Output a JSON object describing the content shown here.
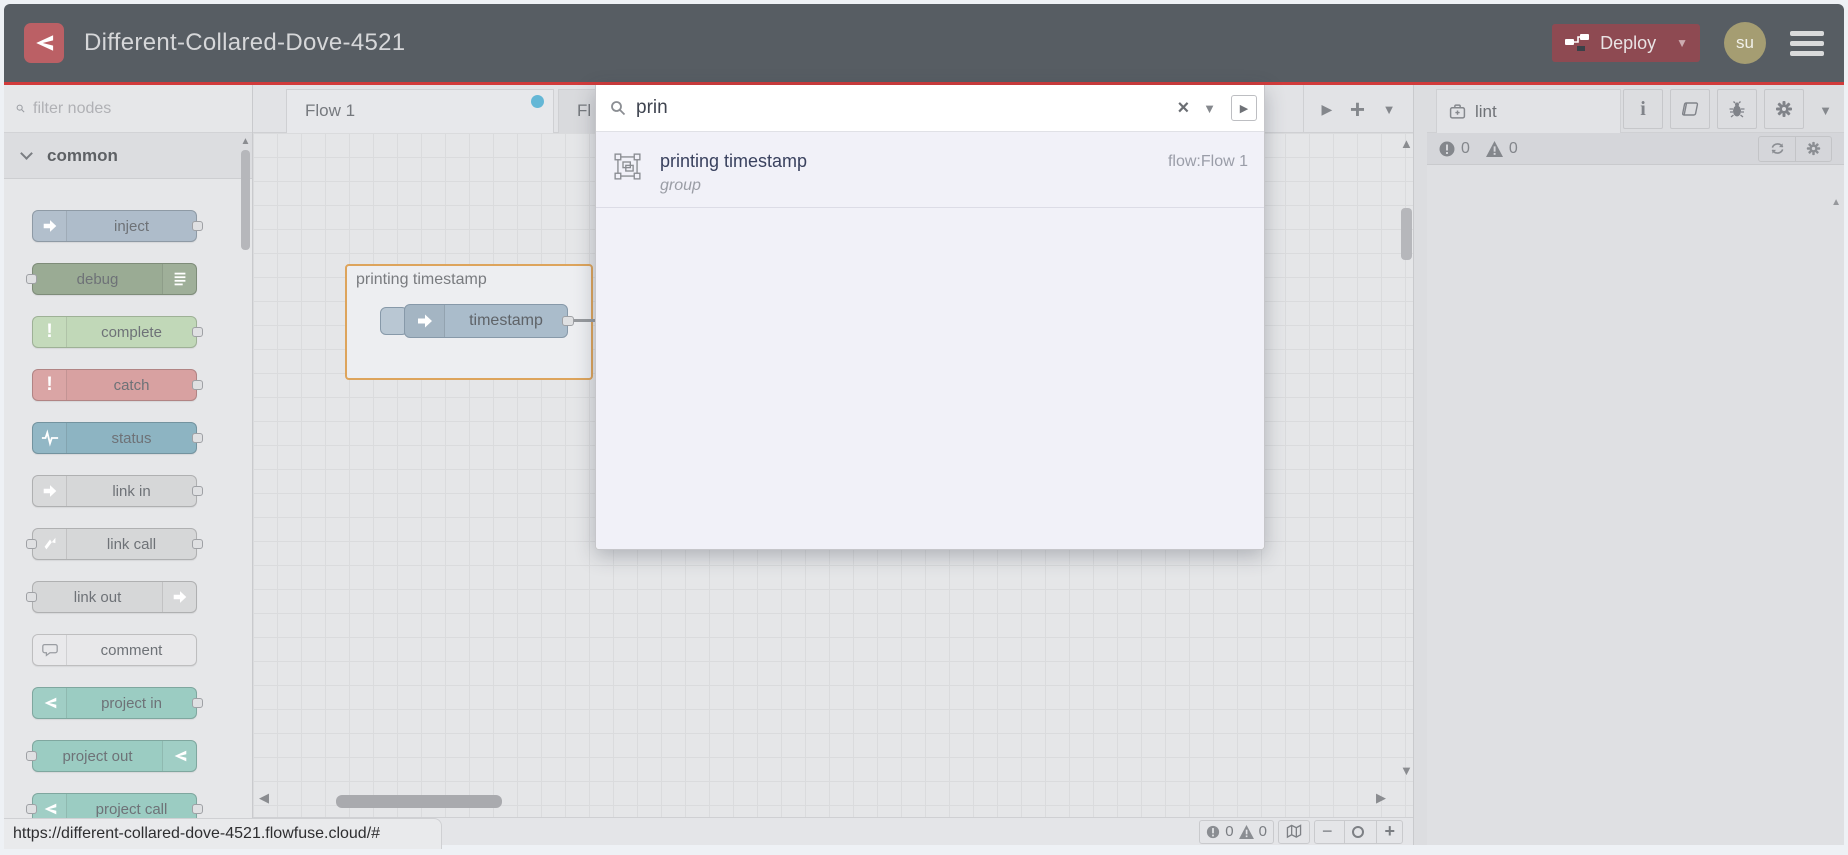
{
  "header": {
    "title": "Different-Collared-Dove-4521",
    "deploy_label": "Deploy",
    "avatar_initials": "su",
    "colors": {
      "bg": "#575d63",
      "accent_red": "#d13b3b",
      "deploy_bg": "#8e4a52",
      "avatar_bg": "#a59d72",
      "logo_bg": "#bb6065"
    }
  },
  "palette": {
    "filter_placeholder": "filter nodes",
    "category_label": "common",
    "nodes": [
      {
        "label": "inject",
        "color": "#aebcca"
      },
      {
        "label": "debug",
        "color": "#9aab94"
      },
      {
        "label": "complete",
        "color": "#c1d8b8"
      },
      {
        "label": "catch",
        "color": "#d8a1a1"
      },
      {
        "label": "status",
        "color": "#8db4c2"
      },
      {
        "label": "link in",
        "color": "#d6d7d8"
      },
      {
        "label": "link call",
        "color": "#d6d7d8"
      },
      {
        "label": "link out",
        "color": "#d6d7d8"
      },
      {
        "label": "comment",
        "color": "#e8e8ea"
      },
      {
        "label": "project in",
        "color": "#9bccc2"
      },
      {
        "label": "project out",
        "color": "#9bccc2"
      },
      {
        "label": "project call",
        "color": "#9bccc2"
      }
    ]
  },
  "workspace": {
    "tabs": [
      {
        "label": "Flow 1",
        "active": true,
        "modified": true
      },
      {
        "label": "Fl",
        "active": false
      }
    ],
    "group_label": "printing timestamp",
    "node_label": "timestamp",
    "footer": {
      "errors": "0",
      "warnings": "0",
      "zoom_out": "−",
      "zoom_in": "+"
    },
    "colors": {
      "canvas_bg": "#e5e6e8",
      "group_border": "#dda45c",
      "modified_dot": "#64b7d6",
      "node_bg": "#aabccb"
    }
  },
  "search": {
    "query": "prin",
    "clear_glyph": "×",
    "results": [
      {
        "title": "printing timestamp",
        "type": "group",
        "location": "flow:Flow 1"
      }
    ]
  },
  "sidebar": {
    "tab_label": "lint",
    "errors": "0",
    "warnings": "0"
  },
  "statusbar": {
    "url": "https://different-collared-dove-4521.flowfuse.cloud/#"
  }
}
